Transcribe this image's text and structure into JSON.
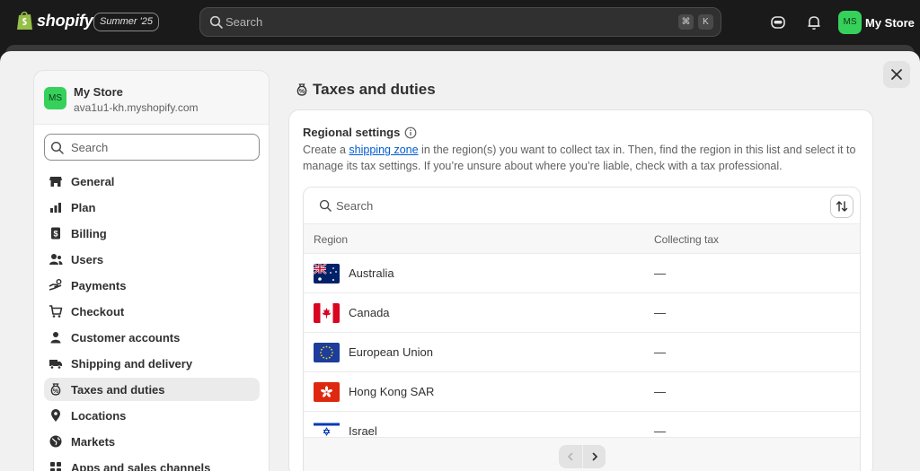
{
  "topbar": {
    "logo_text": "shopify",
    "edition": "Summer '25",
    "search_placeholder": "Search",
    "shortcut_cmd": "⌘",
    "shortcut_key": "K",
    "store_initials": "MS",
    "store_name": "My Store"
  },
  "sidebar": {
    "store_initials": "MS",
    "store_name": "My Store",
    "store_domain": "ava1u1-kh.myshopify.com",
    "search_placeholder": "Search",
    "items": [
      {
        "label": "General",
        "icon": "store-icon"
      },
      {
        "label": "Plan",
        "icon": "plan-icon"
      },
      {
        "label": "Billing",
        "icon": "billing-icon"
      },
      {
        "label": "Users",
        "icon": "users-icon"
      },
      {
        "label": "Payments",
        "icon": "payments-icon"
      },
      {
        "label": "Checkout",
        "icon": "cart-icon"
      },
      {
        "label": "Customer accounts",
        "icon": "person-icon"
      },
      {
        "label": "Shipping and delivery",
        "icon": "truck-icon"
      },
      {
        "label": "Taxes and duties",
        "icon": "tax-icon",
        "active": true
      },
      {
        "label": "Locations",
        "icon": "location-icon"
      },
      {
        "label": "Markets",
        "icon": "globe-icon"
      },
      {
        "label": "Apps and sales channels",
        "icon": "apps-icon"
      }
    ]
  },
  "main": {
    "title": "Taxes and duties",
    "section_title": "Regional settings",
    "desc_before": "Create a ",
    "desc_link": "shipping zone",
    "desc_after": " in the region(s) you want to collect tax in. Then, find the region in this list and select it to manage its tax settings. If you’re unsure about where you’re liable, check with a tax professional.",
    "table_search_placeholder": "Search",
    "col_region": "Region",
    "col_collecting": "Collecting tax",
    "rows": [
      {
        "region": "Australia",
        "collecting": "—"
      },
      {
        "region": "Canada",
        "collecting": "—"
      },
      {
        "region": "European Union",
        "collecting": "—"
      },
      {
        "region": "Hong Kong SAR",
        "collecting": "—"
      },
      {
        "region": "Israel",
        "collecting": "—"
      }
    ]
  },
  "colors": {
    "accent_link": "#005bd3",
    "avatar_green": "#36d15b",
    "topbar_bg": "#1a1a1a"
  }
}
